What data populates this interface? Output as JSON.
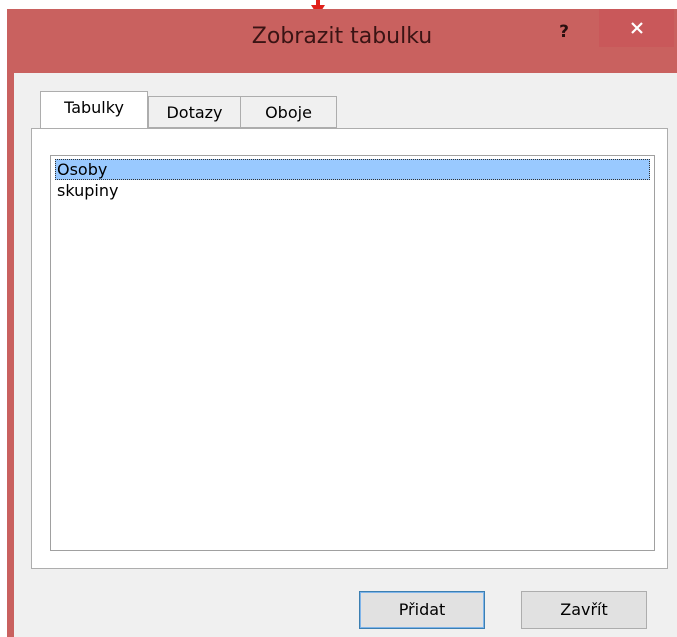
{
  "window": {
    "title": "Zobrazit tabulku",
    "help_label": "?",
    "close_icon": "close-icon"
  },
  "tabs": [
    {
      "label": "Tabulky",
      "active": true
    },
    {
      "label": "Dotazy",
      "active": false
    },
    {
      "label": "Oboje",
      "active": false
    }
  ],
  "list": {
    "items": [
      {
        "label": "Osoby",
        "selected": true
      },
      {
        "label": "skupiny",
        "selected": false
      }
    ]
  },
  "buttons": {
    "add_label": "Přidat",
    "close_label": "Zavřít"
  },
  "colors": {
    "titlebar": "#c9615f",
    "selection": "#99c9ff",
    "pointer_arrow": "#e0201a"
  }
}
